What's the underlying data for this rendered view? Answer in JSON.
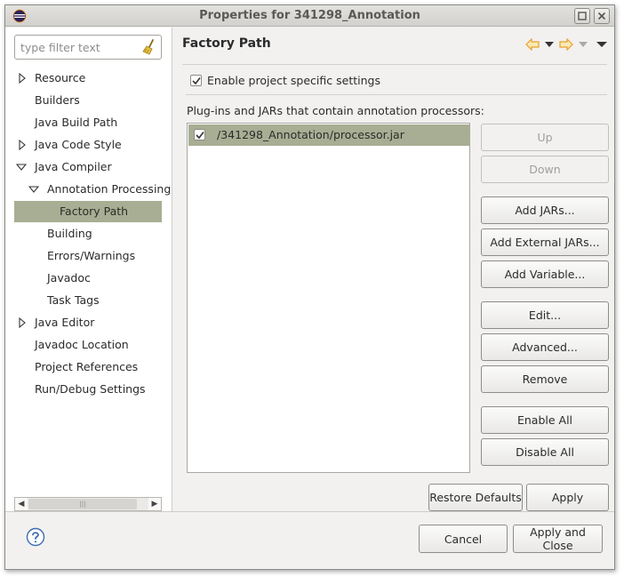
{
  "window": {
    "title": "Properties for 341298_Annotation"
  },
  "filter": {
    "placeholder": "type filter text"
  },
  "tree": {
    "items": [
      {
        "label": "Resource",
        "expandable": true,
        "expanded": false
      },
      {
        "label": "Builders"
      },
      {
        "label": "Java Build Path"
      },
      {
        "label": "Java Code Style",
        "expandable": true,
        "expanded": false
      },
      {
        "label": "Java Compiler",
        "expandable": true,
        "expanded": true
      },
      {
        "label": "Annotation Processing",
        "expandable": true,
        "expanded": true
      },
      {
        "label": "Factory Path",
        "selected": true
      },
      {
        "label": "Building"
      },
      {
        "label": "Errors/Warnings"
      },
      {
        "label": "Javadoc"
      },
      {
        "label": "Task Tags"
      },
      {
        "label": "Java Editor",
        "expandable": true,
        "expanded": false
      },
      {
        "label": "Javadoc Location"
      },
      {
        "label": "Project References"
      },
      {
        "label": "Run/Debug Settings"
      }
    ]
  },
  "page": {
    "title": "Factory Path",
    "enable_label": "Enable project specific settings",
    "enable_checked": true,
    "plugins_label": "Plug-ins and JARs that contain annotation processors:",
    "jars": [
      {
        "path": "/341298_Annotation/processor.jar",
        "checked": true
      }
    ]
  },
  "buttons": {
    "up": "Up",
    "down": "Down",
    "add_jars": "Add JARs...",
    "add_external_jars": "Add External JARs...",
    "add_variable": "Add Variable...",
    "edit": "Edit...",
    "advanced": "Advanced...",
    "remove": "Remove",
    "enable_all": "Enable All",
    "disable_all": "Disable All",
    "restore_defaults": "Restore Defaults",
    "apply": "Apply",
    "cancel": "Cancel",
    "apply_and_close": "Apply and Close"
  },
  "colors": {
    "selection": "#a8ae93",
    "nav_arrow": "#e8a02c",
    "dialog_bg": "#f2f1f0"
  }
}
